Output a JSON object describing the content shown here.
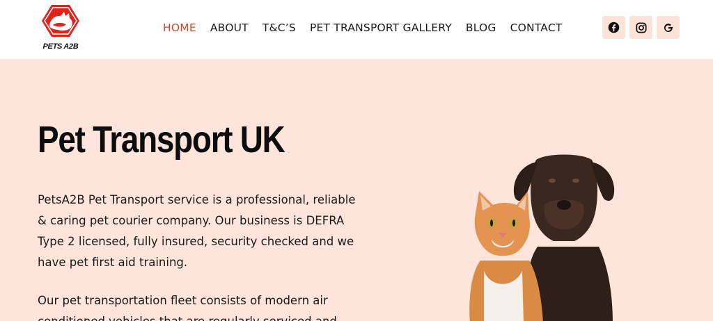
{
  "brand": {
    "logo_text": "PETS A2B",
    "accent": "#e0231b"
  },
  "nav": {
    "items": [
      {
        "label": "HOME",
        "active": true
      },
      {
        "label": "ABOUT"
      },
      {
        "label": "T&C’S"
      },
      {
        "label": "PET TRANSPORT GALLERY"
      },
      {
        "label": "BLOG"
      },
      {
        "label": "CONTACT"
      }
    ],
    "active_color": "#d6452a"
  },
  "social": {
    "icons": [
      "facebook-icon",
      "instagram-icon",
      "google-icon"
    ]
  },
  "hero": {
    "title": "Pet Transport UK",
    "paragraph1": "PetsA2B Pet Transport service is a professional, reliable & caring pet courier company. Our business is DEFRA Type 2 licensed, fully insured, security checked and we have pet first aid training.",
    "paragraph2": "Our pet transportation fleet consists of modern air conditioned vehicles that are regularly serviced and",
    "background": "#fde5db"
  }
}
